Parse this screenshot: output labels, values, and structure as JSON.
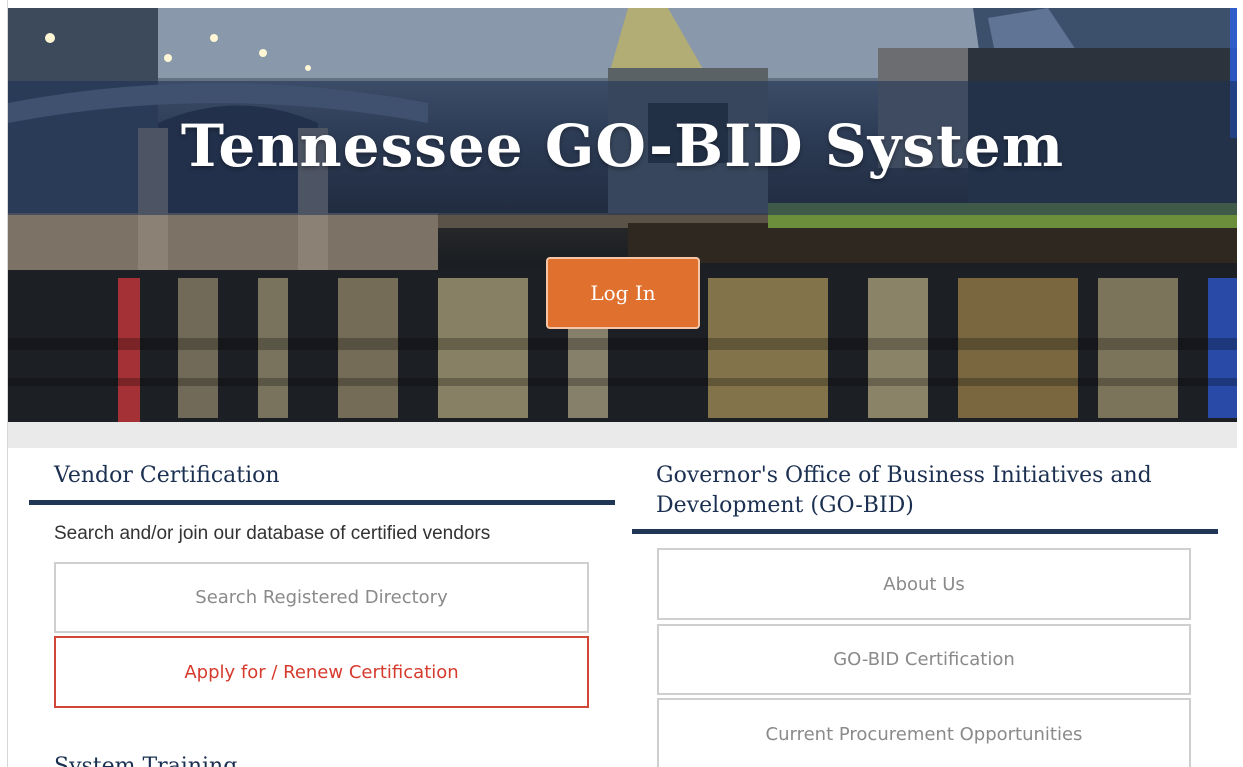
{
  "hero": {
    "title": "Tennessee GO-BID System",
    "login_label": "Log In"
  },
  "vendor": {
    "heading": "Vendor Certification",
    "description": "Search and/or join our database of certified vendors",
    "search_label": "Search Registered Directory",
    "apply_label": "Apply for / Renew Certification"
  },
  "training": {
    "heading": "System Training"
  },
  "gobid": {
    "heading_line1": "Governor's Office of Business Initiatives and",
    "heading_line2": "Development (GO-BID)",
    "about_label": "About Us",
    "certification_label": "GO-BID Certification",
    "procurement_label": "Current Procurement Opportunities"
  },
  "colors": {
    "navy": "#1f3656",
    "login_orange": "#e0702e",
    "apply_red": "#d2463a"
  }
}
